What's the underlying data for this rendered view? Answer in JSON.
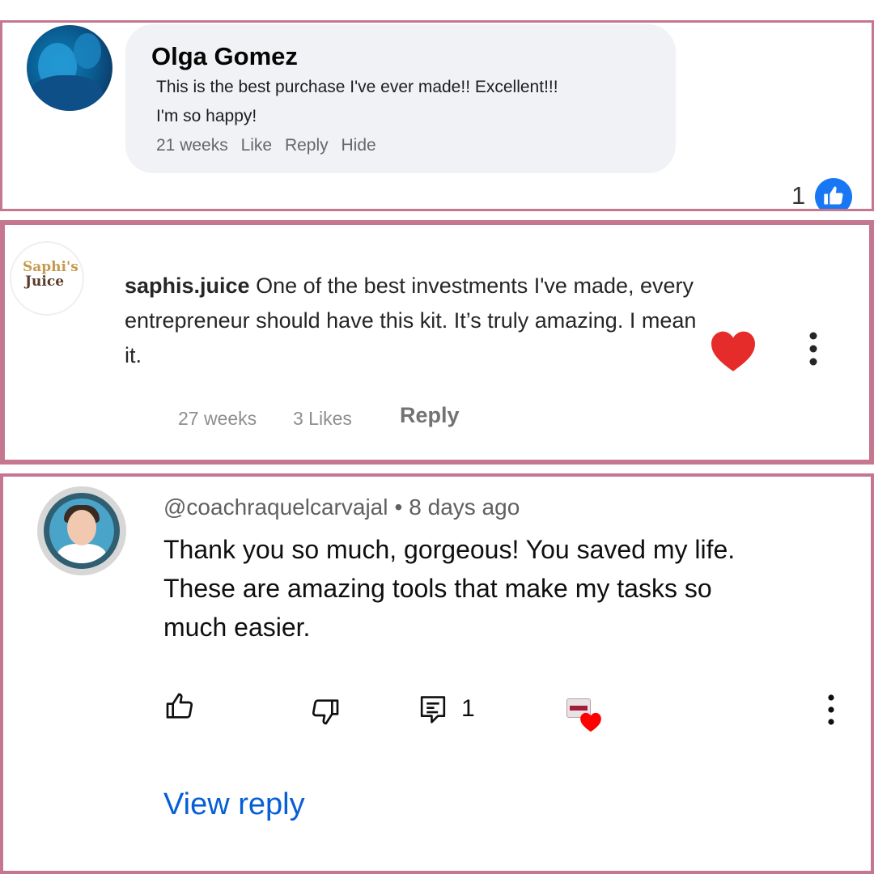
{
  "comments": {
    "facebook": {
      "name": "Olga Gomez",
      "text_line1": "This is the best purchase I've ever made!! Excellent!!!",
      "text_line2": "I'm so happy!",
      "time": "21 weeks",
      "like": "Like",
      "reply": "Reply",
      "hide": "Hide",
      "reaction_count": "1",
      "reaction_icon": "thumbs-up-icon",
      "accent_color": "#1877f2"
    },
    "instagram": {
      "username": "saphis.juice",
      "text": "One of the best investments I've made, every entrepreneur should have this kit. It’s truly amazing. I mean it.",
      "time": "27 weeks",
      "likes": "3 Likes",
      "reply": "Reply",
      "avatar_logo_top": "Saphi's",
      "avatar_logo_bottom": "Juice",
      "heart_color": "#e62b2b"
    },
    "youtube": {
      "handle": "@coachraquelcarvajal",
      "separator": "•",
      "time": "8 days ago",
      "text": "Thank you so much, gorgeous! You saved my life. These are amazing tools that make my tasks so much easier.",
      "reply_count": "1",
      "view_reply": "View reply",
      "link_color": "#065fd4"
    }
  },
  "frame_color": "#c4778e"
}
